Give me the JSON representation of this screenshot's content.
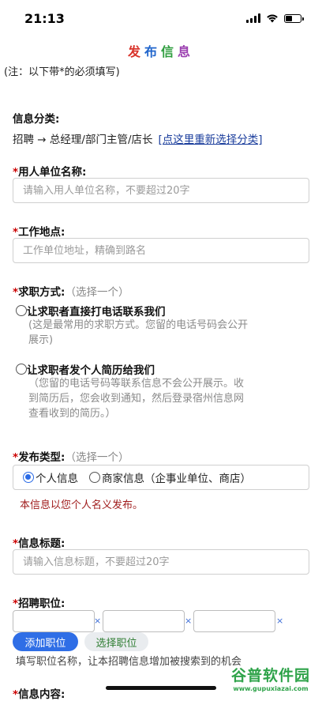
{
  "status": {
    "time": "21:13"
  },
  "title": {
    "chars": [
      "发",
      "布",
      "信",
      "息"
    ],
    "colors": [
      "#d9342b",
      "#2266cc",
      "#2e9d3e",
      "#9b3fb0"
    ]
  },
  "note": "(注：以下带*的必须填写)",
  "category": {
    "label": "信息分类:",
    "path": "招聘 → 总经理/部门主管/店长",
    "reselect_link": "[点这里重新选择分类]"
  },
  "employer": {
    "required_mark": "*",
    "label": "用人单位名称:",
    "placeholder": "请输入用人单位名称，不要超过20字"
  },
  "location": {
    "required_mark": "*",
    "label": "工作地点:",
    "placeholder": "工作单位地址，精确到路名"
  },
  "apply_method": {
    "required_mark": "*",
    "label": "求职方式:",
    "hint": "（选择一个）",
    "options": [
      {
        "label": "让求职者直接打电话联系我们",
        "desc_line1": "(这是最常用的求职方式。您留的电话号码会公开",
        "desc_line2": "展示)"
      },
      {
        "label": "让求职者发个人简历给我们",
        "desc_line1": "（您留的电话号码等联系信息不会公开展示。收",
        "desc_line2": "到简历后，您会收到通知，然后登录宿州信息网",
        "desc_line3": "查看收到的简历。）"
      }
    ]
  },
  "publish_type": {
    "required_mark": "*",
    "label": "发布类型:",
    "hint": "（选择一个）",
    "options": [
      "个人信息",
      "商家信息（企事业单位、商店）"
    ],
    "selected": "个人信息",
    "notice": "本信息以您个人名义发布。"
  },
  "info_title": {
    "required_mark": "*",
    "label": "信息标题:",
    "placeholder": "请输入信息标题，不要超过20字"
  },
  "positions": {
    "required_mark": "*",
    "label": "招聘职位:",
    "remove_symbol": "×",
    "add_button": "添加职位",
    "select_button": "选择职位",
    "hint": "填写职位名称，让本招聘信息增加被搜索到的机会"
  },
  "content": {
    "required_mark": "*",
    "label": "信息内容:"
  },
  "watermark": {
    "main": "谷普软件园",
    "sub": "www.gupuxiazai.com"
  }
}
